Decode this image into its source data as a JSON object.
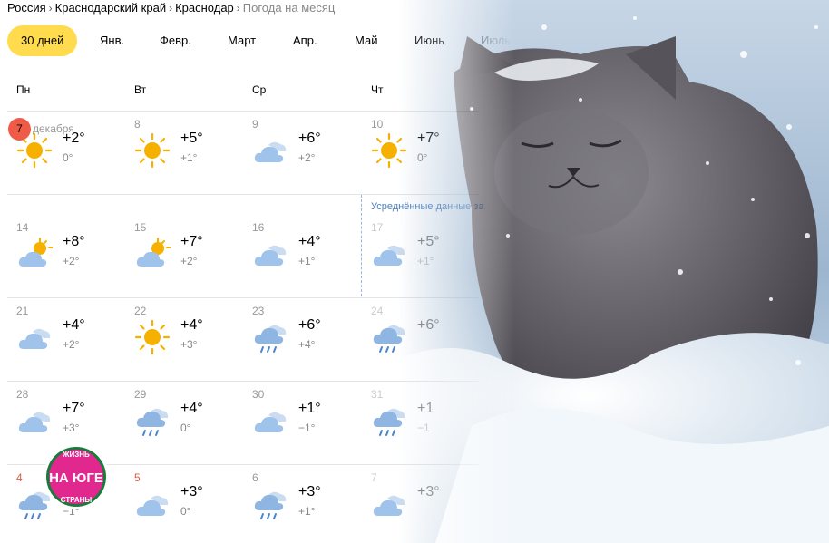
{
  "breadcrumb": [
    "Россия",
    "Краснодарский край",
    "Краснодар",
    "Погода на месяц"
  ],
  "tabs": [
    "30 дней",
    "Янв.",
    "Февр.",
    "Март",
    "Апр.",
    "Май",
    "Июнь",
    "Июль"
  ],
  "weekdays": [
    "Пн",
    "Вт",
    "Ср",
    "Чт"
  ],
  "averaged_label": "Усреднённые данные за",
  "today": {
    "day": "7",
    "month": "декабря"
  },
  "rows": [
    [
      {
        "day": "",
        "icon": "sun-icon",
        "day_temp": "+2°",
        "night_temp": "0°"
      },
      {
        "day": "8",
        "icon": "sun-icon",
        "day_temp": "+5°",
        "night_temp": "+1°"
      },
      {
        "day": "9",
        "icon": "cloudy-icon",
        "day_temp": "+6°",
        "night_temp": "+2°"
      },
      {
        "day": "10",
        "icon": "sun-icon",
        "day_temp": "+7°",
        "night_temp": "0°"
      }
    ],
    [
      {
        "day": "14",
        "icon": "partly-cloudy-icon",
        "day_temp": "+8°",
        "night_temp": "+2°"
      },
      {
        "day": "15",
        "icon": "partly-cloudy-icon",
        "day_temp": "+7°",
        "night_temp": "+2°"
      },
      {
        "day": "16",
        "icon": "cloudy-icon",
        "day_temp": "+4°",
        "night_temp": "+1°"
      },
      {
        "day": "17",
        "icon": "cloudy-icon",
        "day_temp": "+5°",
        "night_temp": "+1°"
      }
    ],
    [
      {
        "day": "21",
        "icon": "cloudy-icon",
        "day_temp": "+4°",
        "night_temp": "+2°"
      },
      {
        "day": "22",
        "icon": "sun-icon",
        "day_temp": "+4°",
        "night_temp": "+3°"
      },
      {
        "day": "23",
        "icon": "rain-icon",
        "day_temp": "+6°",
        "night_temp": "+4°"
      },
      {
        "day": "24",
        "icon": "rain-icon",
        "day_temp": "+6°",
        "night_temp": ""
      }
    ],
    [
      {
        "day": "28",
        "icon": "cloudy-icon",
        "day_temp": "+7°",
        "night_temp": "+3°"
      },
      {
        "day": "29",
        "icon": "rain-icon",
        "day_temp": "+4°",
        "night_temp": "0°"
      },
      {
        "day": "30",
        "icon": "cloudy-icon",
        "day_temp": "+1°",
        "night_temp": "−1°"
      },
      {
        "day": "31",
        "icon": "rain-icon",
        "day_temp": "+1",
        "night_temp": "−1"
      }
    ],
    [
      {
        "day": "4",
        "icon": "rain-icon",
        "day_temp": "",
        "night_temp": "−1°"
      },
      {
        "day": "5",
        "icon": "cloudy-icon",
        "day_temp": "+3°",
        "night_temp": "0°"
      },
      {
        "day": "6",
        "icon": "rain-icon",
        "day_temp": "+3°",
        "night_temp": "+1°"
      },
      {
        "day": "7",
        "icon": "cloudy-icon",
        "day_temp": "+3°",
        "night_temp": ""
      }
    ]
  ],
  "logo": {
    "top": "ЖИЗНЬ",
    "main": "НА ЮГЕ",
    "bottom": "СТРАНЫ"
  },
  "colors": {
    "accent_tab": "#ffdb4d",
    "today_circle": "#ef5b46",
    "holiday": "#e05a40",
    "sun": "#f6b100",
    "cloud": "#9fc3ea",
    "logo": "#e0288f"
  }
}
